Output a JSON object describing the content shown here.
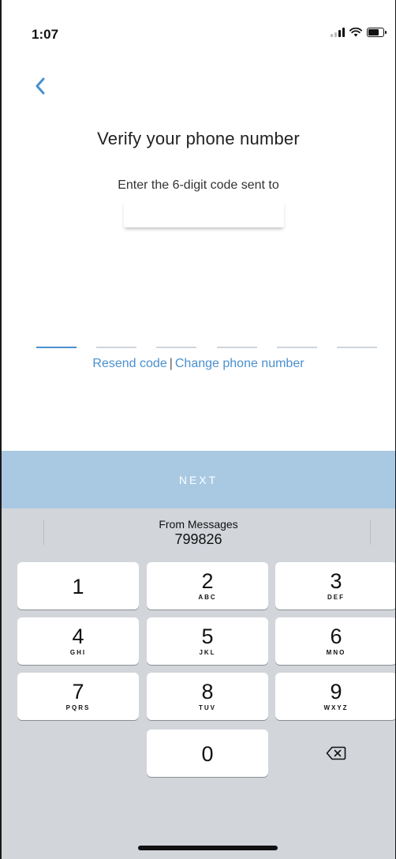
{
  "status_bar": {
    "time": "1:07",
    "signal_icon": "cellular-signal-icon",
    "wifi_icon": "wifi-icon",
    "battery_icon": "battery-icon"
  },
  "header": {
    "back_icon": "chevron-left-icon",
    "title": "Verify your phone number"
  },
  "verification": {
    "subtitle": "Enter the 6-digit code sent to",
    "phone_number": "",
    "code_slots": [
      "",
      "",
      "",
      "",
      "",
      ""
    ]
  },
  "links": {
    "resend": "Resend code",
    "separator": "|",
    "change": "Change phone number"
  },
  "next_button": {
    "label": "NEXT"
  },
  "keyboard": {
    "suggestion": {
      "label": "From Messages",
      "code": "799826"
    },
    "keys": [
      {
        "num": "1",
        "letters": ""
      },
      {
        "num": "2",
        "letters": "ABC"
      },
      {
        "num": "3",
        "letters": "DEF"
      },
      {
        "num": "4",
        "letters": "GHI"
      },
      {
        "num": "5",
        "letters": "JKL"
      },
      {
        "num": "6",
        "letters": "MNO"
      },
      {
        "num": "7",
        "letters": "PQRS"
      },
      {
        "num": "8",
        "letters": "TUV"
      },
      {
        "num": "9",
        "letters": "WXYZ"
      },
      {
        "num": "0",
        "letters": ""
      }
    ],
    "delete_icon": "backspace-icon"
  },
  "colors": {
    "accent": "#4a90cf",
    "next_button": "#a9c9e3",
    "keyboard_bg": "#d2d5da"
  }
}
